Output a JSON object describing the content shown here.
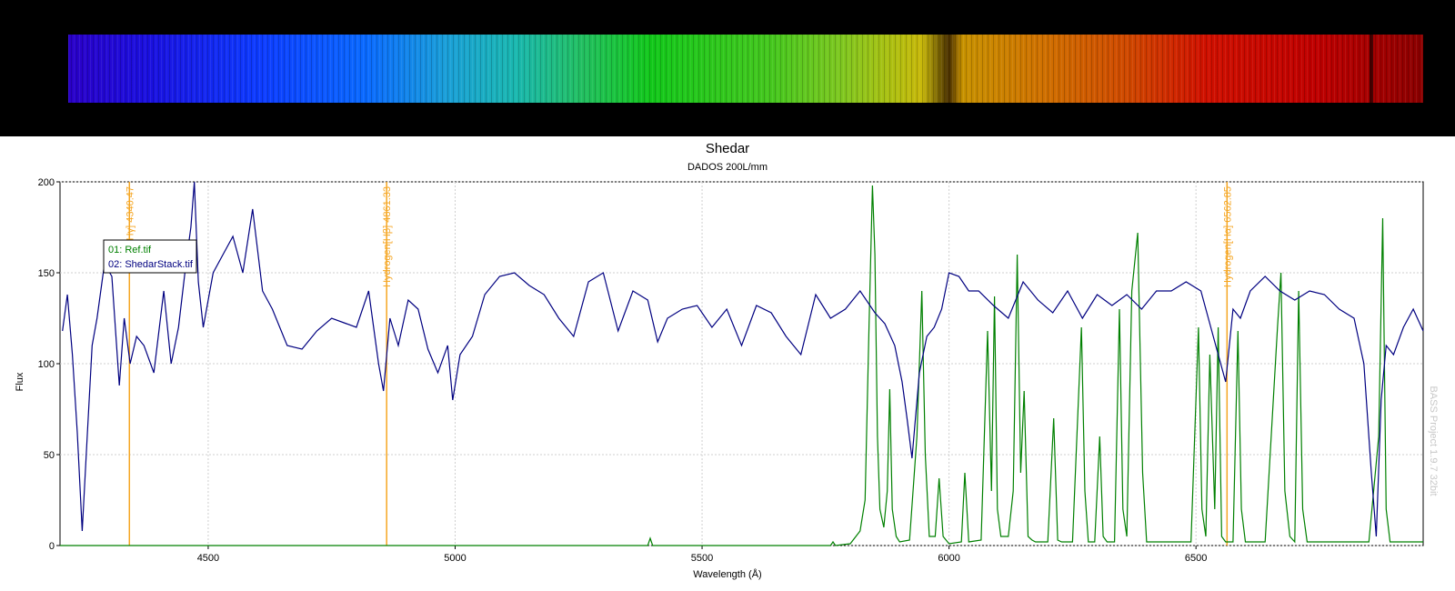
{
  "chart_data": {
    "type": "line",
    "title": "Shedar",
    "subtitle": "DADOS 200L/mm",
    "xlabel": "Wavelength (Å)",
    "ylabel": "Flux",
    "xlim": [
      4200,
      6960
    ],
    "ylim": [
      0,
      200
    ],
    "xticks": [
      4500,
      5000,
      5500,
      6000,
      6500
    ],
    "yticks": [
      0,
      50,
      100,
      150,
      200
    ],
    "grid": true,
    "watermark": "BASS Project 1.9.7 32bit",
    "reference_lines": [
      {
        "label": "Hy[Hγ] 4340.47",
        "x": 4340.47,
        "color": "#f5a623"
      },
      {
        "label": "Hydrogen[Hβ] 4861.33",
        "x": 4861.33,
        "color": "#f5a623"
      },
      {
        "label": "Hydrogen[Hα] 6562.85",
        "x": 6562.85,
        "color": "#f5a623"
      }
    ],
    "legend": {
      "position": "top-left",
      "entries": [
        {
          "label": "01: Ref.tif",
          "color": "#008000"
        },
        {
          "label": "02: ShedarStack.tif",
          "color": "#000080"
        }
      ]
    },
    "series": [
      {
        "name": "01: Ref.tif",
        "color": "#008000",
        "x": [
          4200,
          4300,
          4380,
          4390,
          4400,
          4500,
          4600,
          4700,
          4800,
          4875,
          4880,
          4900,
          5000,
          5100,
          5200,
          5300,
          5390,
          5395,
          5400,
          5420,
          5440,
          5500,
          5600,
          5700,
          5760,
          5765,
          5770,
          5800,
          5820,
          5830,
          5838,
          5845,
          5850,
          5855,
          5860,
          5868,
          5875,
          5880,
          5885,
          5893,
          5900,
          5920,
          5935,
          5945,
          5952,
          5960,
          5972,
          5980,
          5988,
          6000,
          6025,
          6032,
          6040,
          6065,
          6078,
          6086,
          6092,
          6098,
          6105,
          6120,
          6130,
          6138,
          6145,
          6152,
          6160,
          6168,
          6175,
          6200,
          6212,
          6220,
          6228,
          6250,
          6268,
          6275,
          6282,
          6295,
          6305,
          6312,
          6320,
          6335,
          6345,
          6352,
          6360,
          6370,
          6382,
          6392,
          6400,
          6405,
          6412,
          6425,
          6450,
          6490,
          6505,
          6512,
          6520,
          6528,
          6538,
          6545,
          6552,
          6560,
          6575,
          6585,
          6592,
          6600,
          6640,
          6665,
          6672,
          6680,
          6690,
          6700,
          6708,
          6716,
          6725,
          6760,
          6810,
          6850,
          6870,
          6878,
          6885,
          6893,
          6900,
          6915,
          6960
        ],
        "values": [
          0,
          0,
          0,
          0,
          0,
          0,
          0,
          0,
          0,
          0,
          0,
          0,
          0,
          0,
          0,
          0,
          0,
          4,
          0,
          0,
          0,
          0,
          0,
          0,
          0,
          2,
          0,
          1,
          8,
          25,
          120,
          198,
          160,
          60,
          20,
          10,
          30,
          86,
          20,
          5,
          2,
          3,
          60,
          140,
          50,
          5,
          5,
          37,
          5,
          1,
          2,
          40,
          2,
          3,
          118,
          30,
          137,
          20,
          5,
          5,
          30,
          160,
          40,
          85,
          5,
          3,
          2,
          2,
          70,
          3,
          2,
          2,
          120,
          30,
          2,
          2,
          60,
          5,
          2,
          2,
          130,
          20,
          5,
          140,
          172,
          40,
          2,
          2,
          2,
          2,
          2,
          2,
          120,
          20,
          5,
          105,
          20,
          120,
          5,
          2,
          2,
          118,
          20,
          2,
          2,
          120,
          150,
          30,
          5,
          2,
          140,
          20,
          2,
          2,
          2,
          2,
          60,
          180,
          20,
          2,
          2,
          2,
          2
        ]
      },
      {
        "name": "02: ShedarStack.tif",
        "color": "#000080",
        "x": [
          4205,
          4215,
          4225,
          4235,
          4245,
          4255,
          4265,
          4275,
          4290,
          4305,
          4320,
          4330,
          4342,
          4355,
          4370,
          4390,
          4410,
          4425,
          4440,
          4455,
          4465,
          4472,
          4480,
          4490,
          4510,
          4530,
          4550,
          4570,
          4590,
          4610,
          4630,
          4660,
          4690,
          4720,
          4750,
          4780,
          4800,
          4825,
          4845,
          4855,
          4868,
          4885,
          4905,
          4925,
          4945,
          4965,
          4985,
          4995,
          5010,
          5035,
          5060,
          5090,
          5120,
          5150,
          5180,
          5210,
          5240,
          5270,
          5300,
          5330,
          5360,
          5390,
          5410,
          5430,
          5460,
          5490,
          5520,
          5550,
          5580,
          5610,
          5640,
          5670,
          5700,
          5730,
          5760,
          5790,
          5820,
          5850,
          5870,
          5890,
          5905,
          5915,
          5925,
          5940,
          5955,
          5970,
          5985,
          6000,
          6020,
          6040,
          6060,
          6090,
          6120,
          6150,
          6180,
          6210,
          6240,
          6270,
          6300,
          6330,
          6360,
          6390,
          6420,
          6450,
          6480,
          6510,
          6540,
          6560,
          6575,
          6590,
          6610,
          6640,
          6670,
          6700,
          6730,
          6760,
          6790,
          6820,
          6840,
          6855,
          6865,
          6875,
          6885,
          6900,
          6920,
          6940,
          6960
        ],
        "values": [
          118,
          138,
          105,
          62,
          8,
          60,
          110,
          125,
          155,
          148,
          88,
          125,
          100,
          115,
          110,
          95,
          140,
          100,
          120,
          155,
          175,
          202,
          145,
          120,
          150,
          160,
          170,
          150,
          185,
          140,
          130,
          110,
          108,
          118,
          125,
          122,
          120,
          140,
          100,
          85,
          125,
          110,
          135,
          130,
          108,
          95,
          110,
          80,
          105,
          115,
          138,
          148,
          150,
          143,
          138,
          125,
          115,
          145,
          150,
          118,
          140,
          135,
          112,
          125,
          130,
          132,
          120,
          130,
          110,
          132,
          128,
          115,
          105,
          138,
          125,
          130,
          140,
          128,
          122,
          110,
          90,
          70,
          48,
          95,
          115,
          120,
          130,
          150,
          148,
          140,
          140,
          132,
          125,
          145,
          135,
          128,
          140,
          125,
          138,
          132,
          138,
          130,
          140,
          140,
          145,
          140,
          110,
          90,
          130,
          125,
          140,
          148,
          140,
          135,
          140,
          138,
          130,
          125,
          100,
          40,
          5,
          80,
          110,
          105,
          120,
          130,
          118
        ]
      }
    ]
  }
}
